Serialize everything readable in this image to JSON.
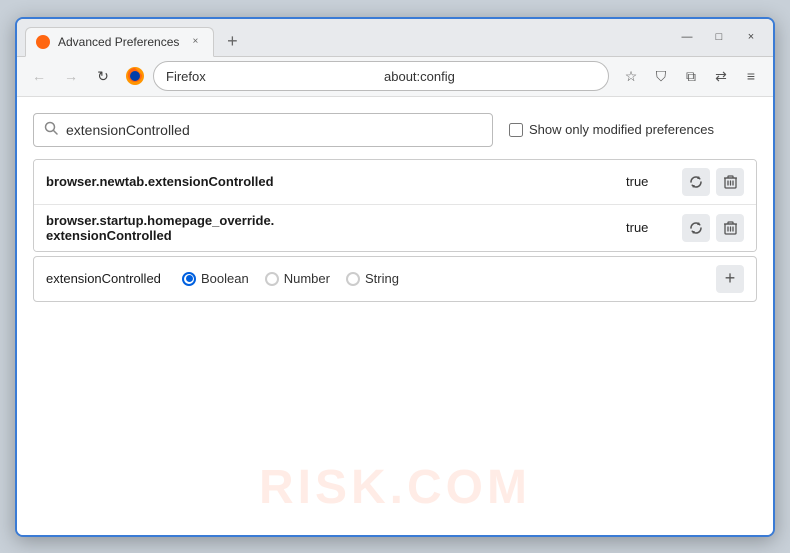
{
  "window": {
    "title": "Advanced Preferences",
    "tab_label": "Advanced Preferences",
    "close_btn": "×",
    "minimize_btn": "—",
    "maximize_btn": "□",
    "new_tab_btn": "+"
  },
  "nav": {
    "back_label": "←",
    "forward_label": "→",
    "reload_label": "↻",
    "browser_name": "Firefox",
    "url": "about:config",
    "bookmark_icon": "☆",
    "pocket_icon": "⛉",
    "extensions_icon": "⧉",
    "sync_icon": "⇄",
    "menu_icon": "≡"
  },
  "search": {
    "placeholder": "extensionControlled",
    "value": "extensionControlled",
    "show_modified_label": "Show only modified preferences"
  },
  "preferences": [
    {
      "name": "browser.newtab.extensionControlled",
      "value": "true"
    },
    {
      "name": "browser.startup.homepage_override.\nextensionControlled",
      "name_line1": "browser.startup.homepage_override.",
      "name_line2": "extensionControlled",
      "value": "true",
      "multiline": true
    }
  ],
  "new_pref": {
    "name": "extensionControlled",
    "types": [
      {
        "label": "Boolean",
        "selected": true
      },
      {
        "label": "Number",
        "selected": false
      },
      {
        "label": "String",
        "selected": false
      }
    ],
    "add_label": "+"
  },
  "watermark": "RISK.COM",
  "icons": {
    "search": "🔍",
    "reset": "⇄",
    "delete": "🗑"
  },
  "colors": {
    "accent": "#0060df",
    "border": "#ccc",
    "tab_active_bg": "#f5f6f7"
  }
}
